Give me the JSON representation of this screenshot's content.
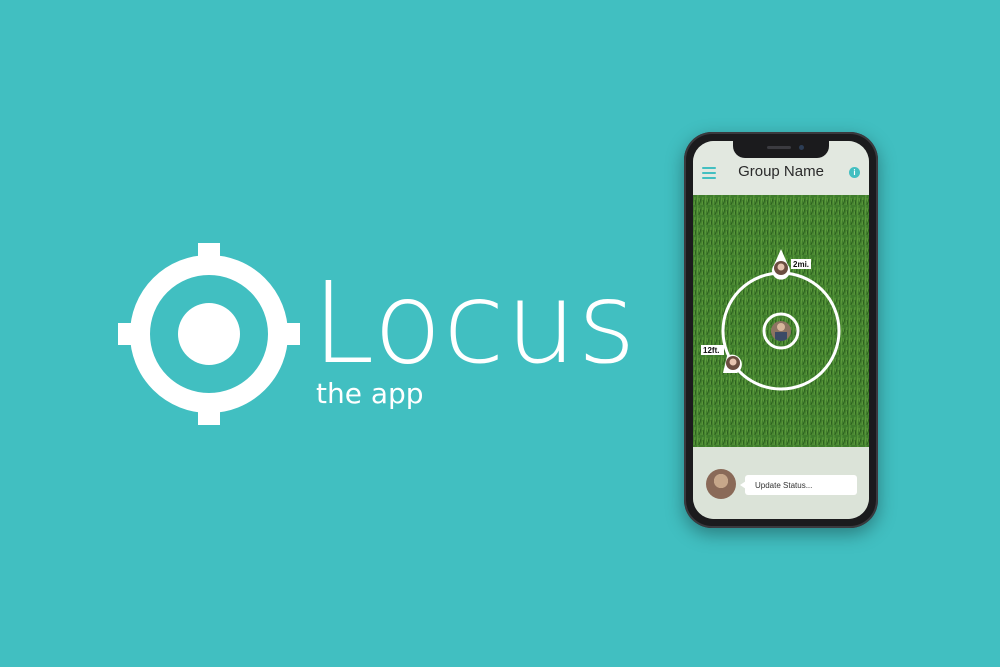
{
  "brand": {
    "name": "Locus",
    "tagline": "the app"
  },
  "colors": {
    "background": "#41bfc1",
    "accent": "#43bfc1",
    "ring": "#ffffff",
    "grass": "#3c7a2a"
  },
  "app": {
    "header": {
      "title": "Group Name",
      "menu_icon": "hamburger-menu-icon",
      "info_icon": "info-icon",
      "info_glyph": "i"
    },
    "map": {
      "members": [
        {
          "distance_label": "2mi."
        },
        {
          "distance_label": "12ft."
        }
      ]
    },
    "status": {
      "placeholder": "Update Status..."
    }
  }
}
